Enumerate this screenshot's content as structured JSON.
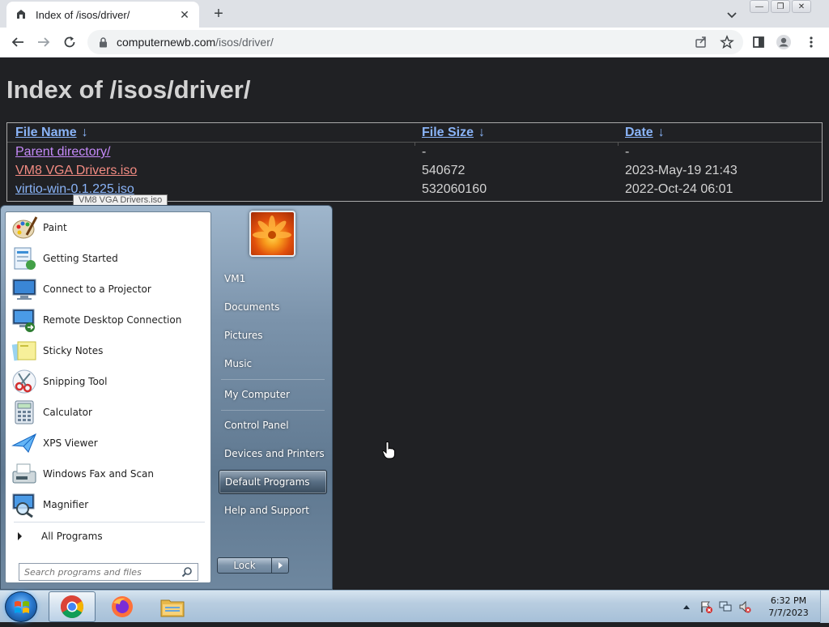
{
  "browser": {
    "tab_title": "Index of /isos/driver/",
    "new_tab": "+",
    "url_host": "computernewb.com",
    "url_path": "/isos/driver/"
  },
  "page": {
    "heading": "Index of /isos/driver/",
    "columns": [
      "File Name",
      "File Size",
      "Date"
    ],
    "sort_arrow": "↓",
    "rows": [
      {
        "name": "Parent directory/",
        "size": "-",
        "date": "-"
      },
      {
        "name": "VM8 VGA Drivers.iso",
        "size": "540672",
        "date": "2023-May-19 21:43"
      },
      {
        "name": "virtio-win-0.1.225.iso",
        "size": "532060160",
        "date": "2022-Oct-24 06:01"
      }
    ],
    "tooltip": "VM8 VGA Drivers.iso"
  },
  "start_menu": {
    "programs": [
      {
        "label": "Paint",
        "icon": "paint-icon"
      },
      {
        "label": "Getting Started",
        "icon": "getting-started-icon"
      },
      {
        "label": "Connect to a Projector",
        "icon": "projector-icon"
      },
      {
        "label": "Remote Desktop Connection",
        "icon": "remote-desktop-icon"
      },
      {
        "label": "Sticky Notes",
        "icon": "sticky-notes-icon"
      },
      {
        "label": "Snipping Tool",
        "icon": "snipping-tool-icon"
      },
      {
        "label": "Calculator",
        "icon": "calculator-icon"
      },
      {
        "label": "XPS Viewer",
        "icon": "xps-viewer-icon"
      },
      {
        "label": "Windows Fax and Scan",
        "icon": "fax-scan-icon"
      },
      {
        "label": "Magnifier",
        "icon": "magnifier-icon"
      }
    ],
    "all_programs": "All Programs",
    "search_placeholder": "Search programs and files",
    "right_items": [
      "VM1",
      "Documents",
      "Pictures",
      "Music",
      "My Computer",
      "Control Panel",
      "Devices and Printers",
      "Default Programs",
      "Help and Support"
    ],
    "highlighted_item": "Default Programs",
    "lock_label": "Lock"
  },
  "taskbar": {
    "time": "6:32 PM",
    "date": "7/7/2023",
    "apps": [
      "chrome-icon",
      "firefox-icon",
      "explorer-icon"
    ]
  },
  "colors": {
    "page_bg": "#202124",
    "link": "#8ab4f8",
    "link_hover": "#f28b82",
    "link_visited": "#c58af9"
  }
}
